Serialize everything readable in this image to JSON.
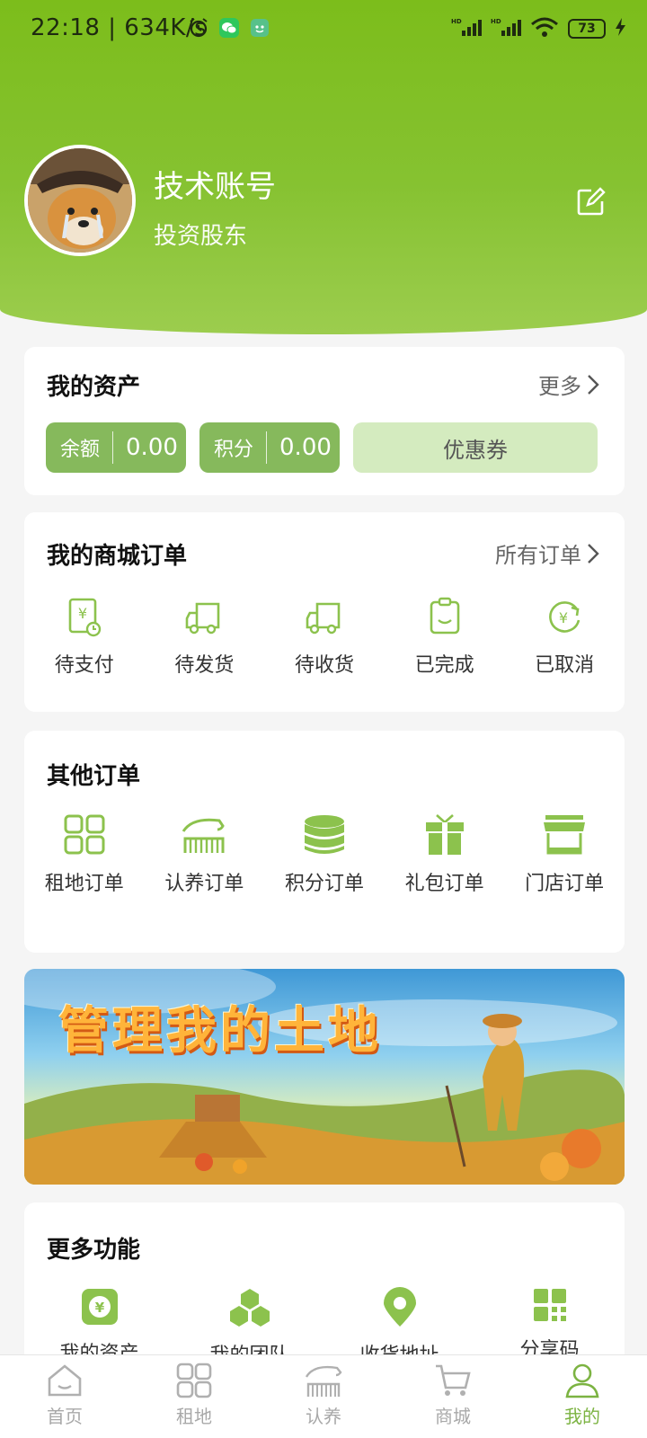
{
  "status_bar": {
    "time": "22:18",
    "speed": "634K/s",
    "battery": "73",
    "icons": [
      "alarm-icon",
      "wechat-icon",
      "app-icon",
      "signal-icon",
      "signal-icon",
      "wifi-icon",
      "charging-icon"
    ]
  },
  "profile": {
    "name": "技术账号",
    "role": "投资股东",
    "edit_icon": "edit-icon"
  },
  "assets": {
    "title": "我的资产",
    "more": "更多",
    "balance_label": "余额",
    "balance_value": "0.00",
    "points_label": "积分",
    "points_value": "0.00",
    "coupon": "优惠券"
  },
  "mall_orders": {
    "title": "我的商城订单",
    "more": "所有订单",
    "items": [
      {
        "label": "待支付",
        "icon": "pending-payment-icon"
      },
      {
        "label": "待发货",
        "icon": "truck-icon"
      },
      {
        "label": "待收货",
        "icon": "truck-icon"
      },
      {
        "label": "已完成",
        "icon": "clipboard-icon"
      },
      {
        "label": "已取消",
        "icon": "refund-icon"
      }
    ]
  },
  "other_orders": {
    "title": "其他订单",
    "items": [
      {
        "label": "租地订单",
        "icon": "grid-icon"
      },
      {
        "label": "认养订单",
        "icon": "farm-icon"
      },
      {
        "label": "积分订单",
        "icon": "coins-icon"
      },
      {
        "label": "礼包订单",
        "icon": "gift-icon"
      },
      {
        "label": "门店订单",
        "icon": "store-icon"
      }
    ]
  },
  "banner": {
    "title": "管理我的土地"
  },
  "more_functions": {
    "title": "更多功能",
    "items": [
      {
        "label": "我的资产",
        "icon": "wallet-icon"
      },
      {
        "label": "我的团队",
        "icon": "team-icon"
      },
      {
        "label": "收货地址",
        "icon": "location-icon"
      },
      {
        "label": "分享码",
        "icon": "qrcode-icon"
      }
    ]
  },
  "tabbar": {
    "items": [
      {
        "label": "首页",
        "icon": "home-icon"
      },
      {
        "label": "租地",
        "icon": "grid-icon"
      },
      {
        "label": "认养",
        "icon": "farm-icon"
      },
      {
        "label": "商城",
        "icon": "cart-icon"
      },
      {
        "label": "我的",
        "icon": "user-icon",
        "active": true
      }
    ]
  },
  "colors": {
    "brand_green": "#7cbd1b",
    "accent_green": "#86b95c",
    "coupon_bg": "#d4ebbf",
    "tab_inactive": "#a8a8a8"
  }
}
